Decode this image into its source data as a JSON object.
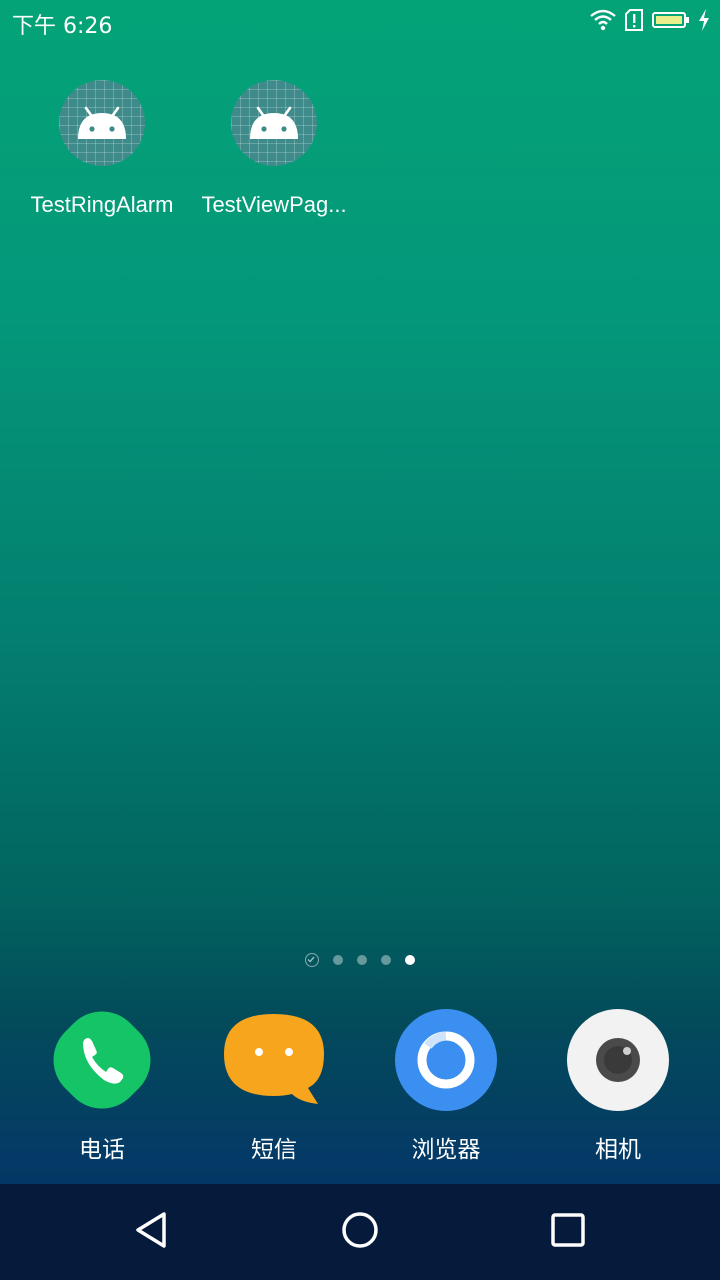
{
  "status_bar": {
    "time": "下午 6:26",
    "icons": [
      "wifi-icon",
      "sim-alert-icon",
      "battery-icon",
      "charging-icon"
    ]
  },
  "home_apps": [
    {
      "label": "TestRingAlarm",
      "icon": "android-icon"
    },
    {
      "label": "TestViewPag...",
      "icon": "android-icon"
    }
  ],
  "page_indicator": {
    "pages": 5,
    "current": 5
  },
  "dock": [
    {
      "label": "电话",
      "icon": "phone-icon",
      "color": "#14c466"
    },
    {
      "label": "短信",
      "icon": "message-icon",
      "color": "#f7a51c"
    },
    {
      "label": "浏览器",
      "icon": "browser-icon",
      "color": "#3a8ff0"
    },
    {
      "label": "相机",
      "icon": "camera-icon",
      "color": "#f2f2f2"
    }
  ],
  "nav_bar": [
    "back-icon",
    "home-icon",
    "recents-icon"
  ]
}
